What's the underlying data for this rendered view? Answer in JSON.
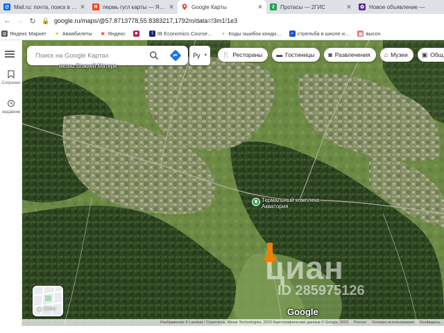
{
  "browser": {
    "tabs": [
      {
        "title": "Mail.ru: почта, поиск в интернете…",
        "icon": "mailru-icon",
        "color": "#005ff9",
        "glyph": "@"
      },
      {
        "title": "пермь гугл карты — Яндекс: наш…",
        "icon": "yandex-icon",
        "color": "#fc3f1d",
        "glyph": "Я"
      },
      {
        "title": "Google Карты",
        "icon": "google-maps-icon",
        "color": "#34a853",
        "glyph": "",
        "active": true
      },
      {
        "title": "Протасы — 2ГИС",
        "icon": "2gis-icon",
        "color": "#1fa04b",
        "glyph": "2"
      },
      {
        "title": "Новое объявление —",
        "icon": "new-ad-icon",
        "color": "#5b2d90",
        "glyph": "✿"
      }
    ],
    "url": "google.ru/maps/@57.8713778,55.8383217,1792m/data=!3m1!1e3",
    "bookmarks": [
      {
        "label": "Яндекс Маркет",
        "icon": "yandex-market-icon",
        "color": "#555"
      },
      {
        "label": "Авиабилеты",
        "icon": "plane-icon",
        "color": "#e8a000"
      },
      {
        "label": "Яндекс",
        "icon": "yandex-bookmark-icon",
        "color": "#fc3f1d"
      },
      {
        "label": "",
        "icon": "bookmark-icon",
        "color": "#c2185b"
      },
      {
        "label": "IB Economics Course…",
        "icon": "ib-icon",
        "color": "#1a237e"
      },
      {
        "label": "Коды ошибок конди…",
        "icon": "bolt-icon",
        "color": "#f2c200"
      },
      {
        "label": "стрельба в школе и…",
        "icon": "search-bookmark-icon",
        "color": "#1a4fd6"
      },
      {
        "label": "высоч",
        "icon": "image-bookmark-icon",
        "color": "#e57373"
      }
    ]
  },
  "rail": {
    "saved_label": "Сохранен",
    "history_label": "недавние"
  },
  "search": {
    "placeholder": "Поиск на Google Картах"
  },
  "language": {
    "value": "Ру"
  },
  "chips": [
    {
      "label": "Рестораны",
      "icon": "restaurant-icon",
      "glyph": "🍴"
    },
    {
      "label": "Гостиницы",
      "icon": "hotel-icon",
      "glyph": "🛏"
    },
    {
      "label": "Развлечения",
      "icon": "camera-icon",
      "glyph": "📷"
    },
    {
      "label": "Музеи",
      "icon": "museum-icon",
      "glyph": "🏛"
    },
    {
      "label": "Общ. т…",
      "icon": "transit-icon",
      "glyph": "🚌"
    }
  ],
  "map": {
    "top_label": "иконы Божией Матери",
    "poi_label_line1": "Термальный комплекс",
    "poi_label_line2": "Акватория",
    "watermark_main": "циан",
    "watermark_id": "ID 285975126",
    "layers_label": "Слои",
    "google_logo": "Google",
    "colors": {
      "poi_pin": "#34a853",
      "arrow": "#f57c00"
    }
  },
  "footer": {
    "attribution": "Изображения © Landsat / Copernicus, Maxar Technologies, 2023 Картографические данные © Google, 2023",
    "country": "Россия",
    "terms": "Условия использования",
    "privacy": "Конфиденц."
  }
}
